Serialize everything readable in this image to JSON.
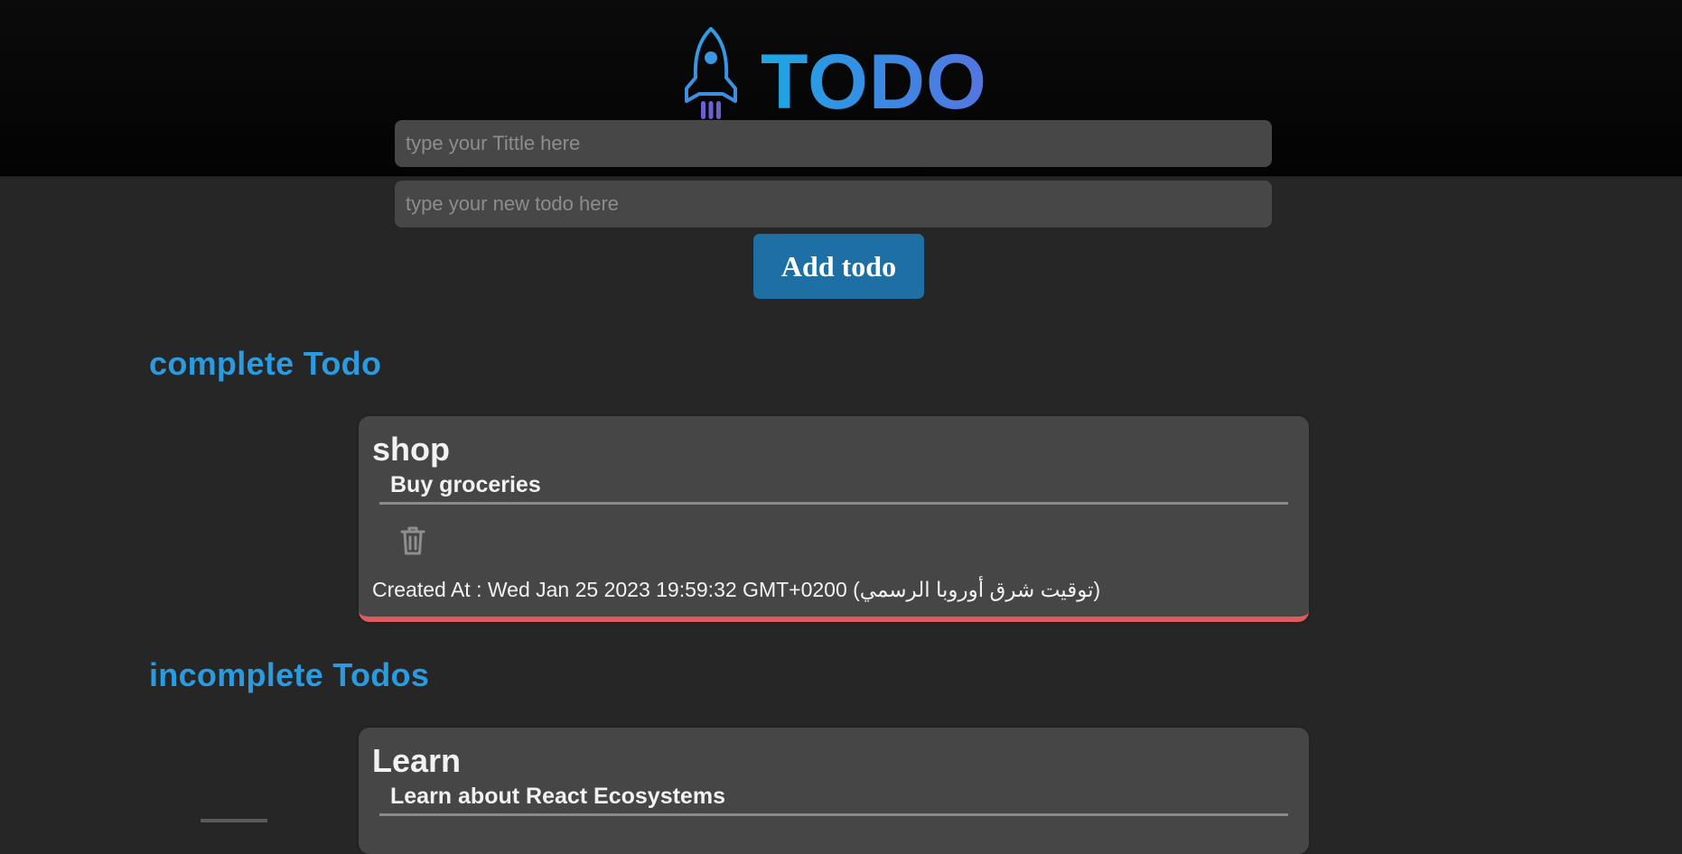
{
  "header": {
    "title": "TODO",
    "logo_icon": "rocket-icon",
    "gradient": [
      "#1da7e3",
      "#5575e0"
    ]
  },
  "form": {
    "title_placeholder": "type your Tittle here",
    "todo_placeholder": "type your new todo here",
    "title_value": "",
    "todo_value": "",
    "add_label": "Add todo"
  },
  "complete": {
    "heading": "complete Todo",
    "items": [
      {
        "title": "shop",
        "description": "Buy groceries",
        "created_label": "Created At : ",
        "created_value": "Wed Jan 25 2023 19:59:32 GMT+0200 (توقيت شرق أوروبا الرسمي)",
        "delete_icon": "trash-icon"
      }
    ]
  },
  "incomplete": {
    "heading": "incomplete Todos",
    "items": [
      {
        "title": "Learn",
        "description": "Learn about React Ecosystems"
      }
    ]
  },
  "colors": {
    "accent": "#2a9be0",
    "button": "#1e6fa4",
    "card": "#464646",
    "complete_border": "#e05b5b",
    "background": "#262626"
  }
}
